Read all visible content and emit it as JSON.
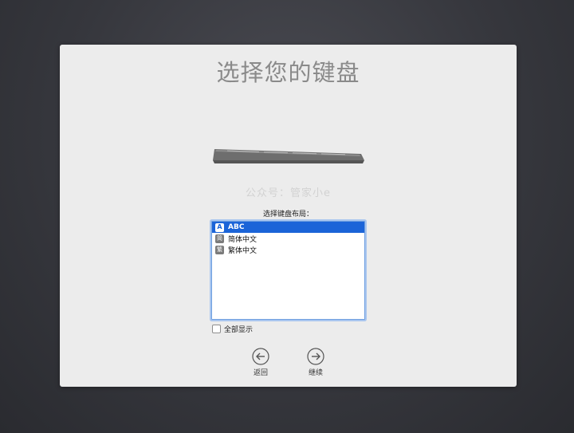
{
  "title": "选择您的键盘",
  "watermark": "公众号：管家小e",
  "layout_label": "选择键盘布局：",
  "layouts": [
    {
      "icon": "A",
      "label": "ABC",
      "selected": true
    },
    {
      "icon": "简",
      "label": "简体中文",
      "selected": false
    },
    {
      "icon": "繁",
      "label": "繁体中文",
      "selected": false
    }
  ],
  "show_all_label": "全部显示",
  "nav": {
    "back_label": "返回",
    "continue_label": "继续"
  },
  "colors": {
    "selection": "#1b64d8",
    "panel": "#ececec",
    "title": "#8a8a8a"
  }
}
